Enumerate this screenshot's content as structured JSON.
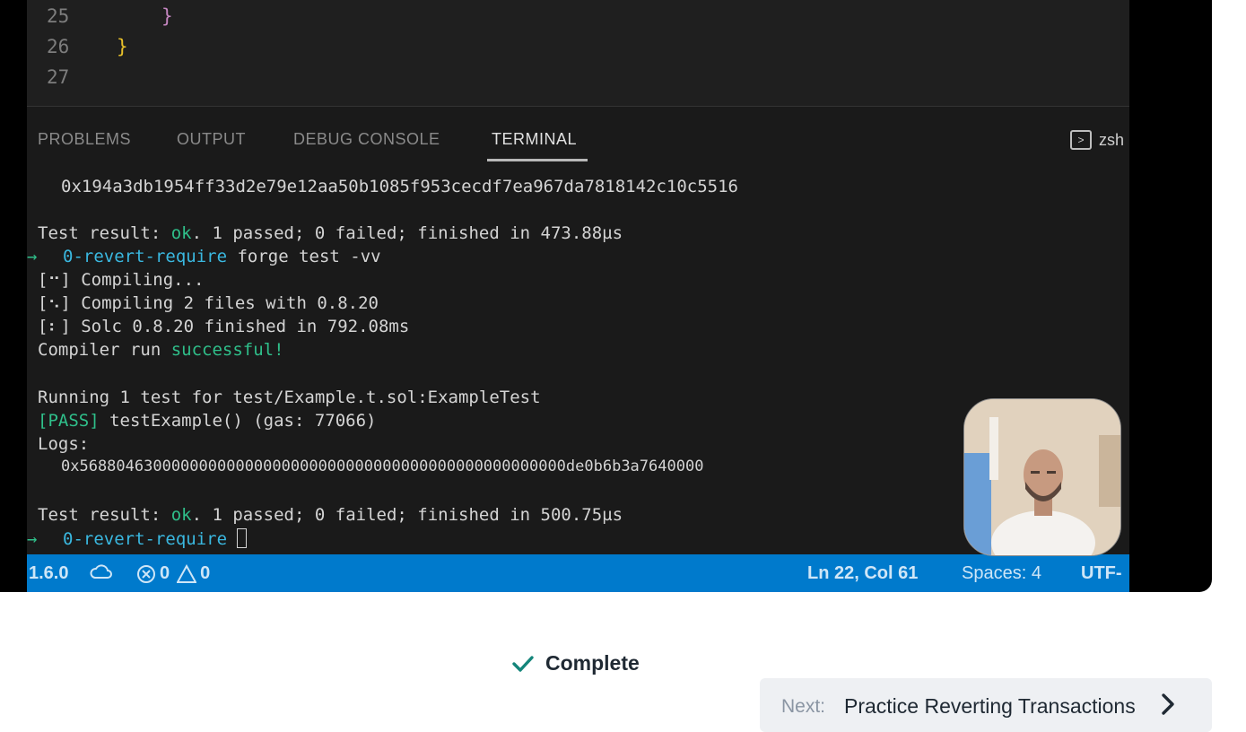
{
  "editor": {
    "lines": [
      {
        "num": "25",
        "code": "}"
      },
      {
        "num": "26",
        "code": "}"
      },
      {
        "num": "27",
        "code": ""
      }
    ]
  },
  "panel": {
    "tabs": [
      "PROBLEMS",
      "OUTPUT",
      "DEBUG CONSOLE",
      "TERMINAL"
    ],
    "active_tab": "TERMINAL",
    "shell": "zsh"
  },
  "terminal": {
    "hash": "0x194a3db1954ff33d2e79e12aa50b1085f953cecdf7ea967da7818142c10c5516",
    "result1_prefix": "Test result: ",
    "result1_ok": "ok",
    "result1_rest": ". 1 passed; 0 failed; finished in 473.88µs",
    "prompt_arrow": "→",
    "prompt_dir": "0-revert-require",
    "command": " forge test -vv",
    "compile_lines": [
      "[⠒] Compiling...",
      "[⠢] Compiling 2 files with 0.8.20",
      "[⠆] Solc 0.8.20 finished in 792.08ms"
    ],
    "compiler_prefix": "Compiler run ",
    "compiler_status": "successful!",
    "running": "Running 1 test for test/Example.t.sol:ExampleTest",
    "pass_tag": "[PASS]",
    "pass_rest": " testExample() (gas: 77066)",
    "logs_label": "Logs:",
    "log_value": "0x56880463000000000000000000000000000000000000000000000de0b6b3a7640000",
    "result2_prefix": "Test result: ",
    "result2_ok": "ok",
    "result2_rest": ". 1 passed; 0 failed; finished in 500.75µs",
    "prompt2_dir": "0-revert-require"
  },
  "statusbar": {
    "version": "1.6.0",
    "errors": "0",
    "warnings": "0",
    "position": "Ln 22, Col 61",
    "spaces": "Spaces: 4",
    "encoding": "UTF-"
  },
  "lesson": {
    "complete_label": "Complete",
    "next_prefix": "Next:",
    "next_title": "Practice Reverting Transactions"
  },
  "colors": {
    "statusbar": "#007acc",
    "terminal_green": "#2fbf8a",
    "terminal_cyan": "#3ab8e0",
    "check_teal": "#14857a"
  }
}
